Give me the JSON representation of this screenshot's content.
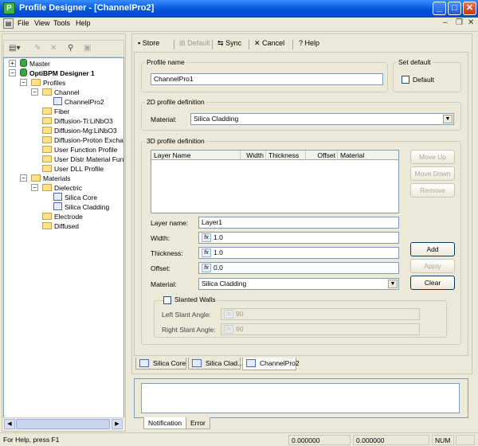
{
  "window": {
    "title": "Profile Designer  - [ChannelPro2]",
    "buttons": {
      "minimize": "_",
      "maximize": "□",
      "close": "✕"
    }
  },
  "menu": {
    "items": [
      "File",
      "View",
      "Tools",
      "Help"
    ],
    "mdi": {
      "minimize": "–",
      "restore": "❐",
      "close": "✕"
    }
  },
  "tree": {
    "items": [
      {
        "label": "Master"
      },
      {
        "label": "OptiBPM Designer 1"
      },
      {
        "label": "Profiles"
      },
      {
        "label": "Channel"
      },
      {
        "label": "ChannelPro2"
      },
      {
        "label": "Fiber"
      },
      {
        "label": "Diffusion-Ti:LiNbO3"
      },
      {
        "label": "Diffusion-Mg:LiNbO3"
      },
      {
        "label": "Diffusion-Proton Excha"
      },
      {
        "label": "User Function Profile"
      },
      {
        "label": "User Distr Material Fun"
      },
      {
        "label": "User DLL Profile"
      },
      {
        "label": "Materials"
      },
      {
        "label": "Dielectric"
      },
      {
        "label": "Silica Core"
      },
      {
        "label": "Silica Cladding"
      },
      {
        "label": "Electrode"
      },
      {
        "label": "Diffused"
      }
    ]
  },
  "toolbar": {
    "store": "Store",
    "default": "Default",
    "sync": "Sync",
    "cancel": "Cancel",
    "help": "Help"
  },
  "form": {
    "profile_name_label": "Profile name",
    "profile_name_value": "ChannelPro1",
    "set_default_label": "Set default",
    "default_checkbox_label": "Default",
    "def2d_label": "2D profile definition",
    "material_label": "Material:",
    "material_2d_value": "Silica Cladding",
    "def3d_label": "3D profile definition",
    "columns": [
      "Layer Name",
      "Width",
      "Thickness",
      "Offset",
      "Material"
    ],
    "move_up": "Move Up",
    "move_down": "Move Down",
    "remove": "Remove",
    "layer_name_label": "Layer name:",
    "layer_name_value": "Layer1",
    "width_label": "Width:",
    "width_value": "1.0",
    "thickness_label": "Thickness:",
    "thickness_value": "1.0",
    "offset_label": "Offset:",
    "offset_value": "0.0",
    "material_3d_value": "Silica Cladding",
    "add": "Add",
    "apply": "Apply",
    "clear": "Clear",
    "slanted_walls_label": "Slanted Walls",
    "left_slant_label": "Left Slant Angle:",
    "left_slant_value": "90",
    "right_slant_label": "Right Slant Angle:",
    "right_slant_value": "90",
    "fx": "fx"
  },
  "doc_tabs": [
    "Silica Core",
    "Silica Clad...",
    "ChannelPro2"
  ],
  "notification_tabs": [
    "Notification",
    "Error"
  ],
  "status": {
    "message": "For Help, press F1",
    "coord1": "0.000000",
    "coord2": "0.000000",
    "num": "NUM"
  }
}
